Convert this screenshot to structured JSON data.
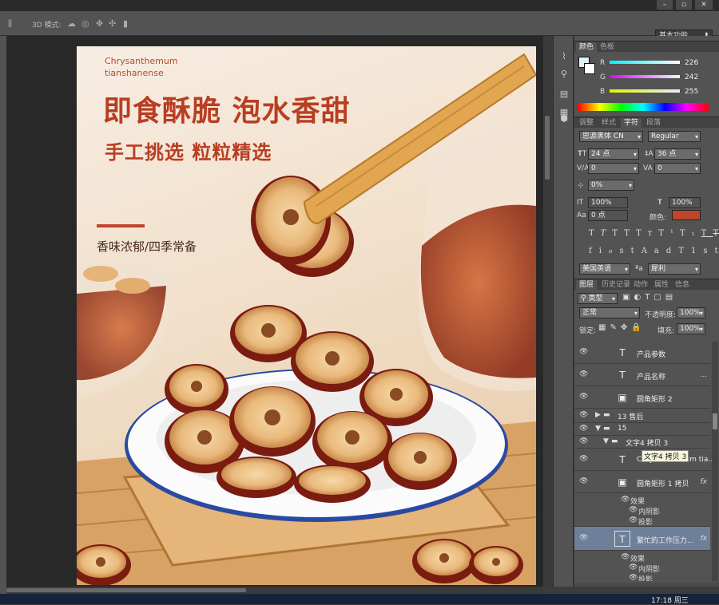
{
  "app": {
    "mode_label": "3D 模式:",
    "workspace": "基本功能"
  },
  "canvas": {
    "en_line1": "Chrysanthemum",
    "en_line2": "tianshanense",
    "headline": "即食酥脆 泡水香甜",
    "subheadline": "手工挑选 粒粒精选",
    "tagline": "香味浓郁/四季常备"
  },
  "color_panel": {
    "tabs": [
      "颜色",
      "色板"
    ],
    "r": "226",
    "g": "242",
    "b": "255",
    "r_label": "R",
    "g_label": "G",
    "b_label": "B"
  },
  "char_panel": {
    "tabs": [
      "调整",
      "样式",
      "字符",
      "段落"
    ],
    "font_family": "思源黑体 CN",
    "font_style": "Regular",
    "size": "24 点",
    "leading": "36 点",
    "kerning": "0",
    "tracking": "0",
    "scale_pct": "0%",
    "vscale": "100%",
    "hscale": "100%",
    "baseline": "0 点",
    "color_label": "颜色:",
    "language": "美国英语",
    "aa_label": "ªa",
    "antialias": "犀利",
    "text_color": "#c0452a"
  },
  "layers_panel": {
    "tabs": [
      "图层",
      "历史记录",
      "动作",
      "属性",
      "信息"
    ],
    "filter": "类型",
    "blend": "正常",
    "opacity_label": "不透明度:",
    "opacity": "100%",
    "lock_label": "锁定:",
    "fill_label": "填充:",
    "fill": "100%",
    "layers": [
      {
        "type": "text",
        "name": "产品参数"
      },
      {
        "type": "text",
        "name": "产品名称",
        "suffix": "..."
      },
      {
        "type": "shape",
        "name": "圆角矩形 2"
      },
      {
        "type": "group",
        "name": "13 售后"
      },
      {
        "type": "group",
        "name": "15"
      },
      {
        "type": "group",
        "name": "文字4 拷贝 3"
      },
      {
        "type": "text",
        "name": "Chrysanthemum tia..."
      },
      {
        "type": "shape",
        "name": "圆角矩形 1 拷贝",
        "fx": "fx"
      },
      {
        "type": "text",
        "name": "繁忙的工作压力...",
        "fx": "fx"
      }
    ],
    "tooltip": "文字4 拷贝 3",
    "effects_label": "效果",
    "inner_shadow": "内阴影",
    "drop_shadow": "投影"
  },
  "taskbar": {
    "time": "17:18 周三"
  }
}
